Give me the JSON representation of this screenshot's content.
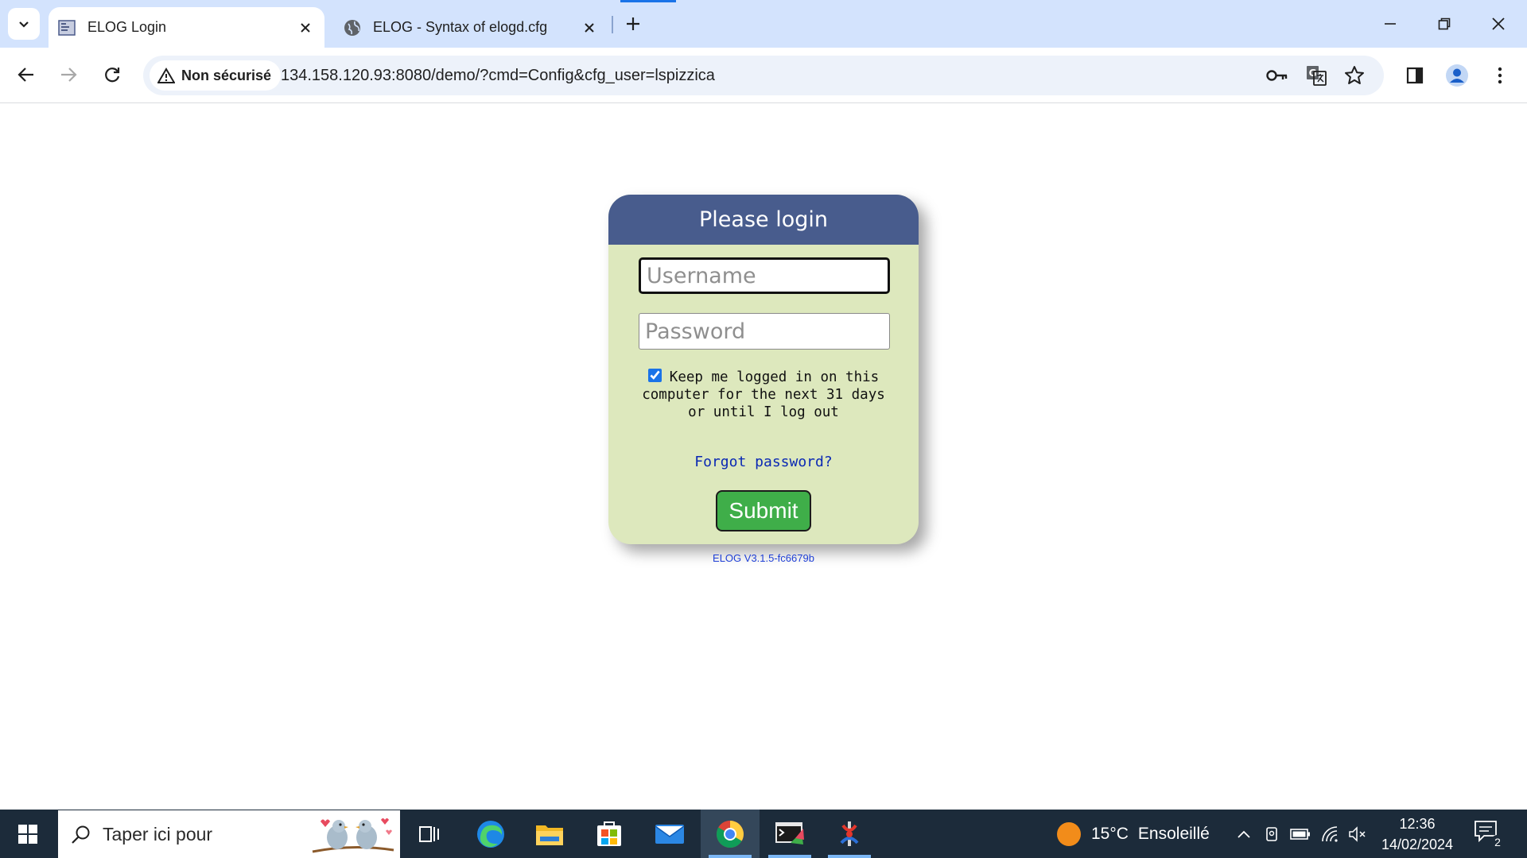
{
  "browser": {
    "tabs": [
      {
        "title": "ELOG Login",
        "active": true
      },
      {
        "title": "ELOG - Syntax of elogd.cfg",
        "active": false
      }
    ],
    "security_label": "Non sécurisé",
    "url": "134.158.120.93:8080/demo/?cmd=Config&cfg_user=lspizzica",
    "icons": {
      "tab_search": "chevron-down-icon",
      "back": "arrow-left-icon",
      "forward": "arrow-right-icon",
      "reload": "reload-icon",
      "password": "key-icon",
      "translate": "translate-icon",
      "bookmark": "star-icon",
      "side_panel": "side-panel-icon",
      "profile": "profile-icon",
      "menu": "kebab-menu-icon"
    }
  },
  "login": {
    "title": "Please login",
    "username_placeholder": "Username",
    "password_placeholder": "Password",
    "keep_logged_in_checked": true,
    "keep_logged_in_label": "Keep me logged in on this computer for the next 31 days or until I log out",
    "forgot_password": "Forgot password?",
    "submit_label": "Submit",
    "version": "ELOG V3.1.5-fc6679b"
  },
  "taskbar": {
    "search_placeholder": "Taper ici pour",
    "weather_temp": "15°C",
    "weather_text": "Ensoleillé",
    "time": "12:36",
    "date": "14/02/2024",
    "notification_count": "2",
    "apps": [
      "task-view-icon",
      "edge-icon",
      "file-explorer-icon",
      "store-icon",
      "mail-icon",
      "chrome-icon",
      "terminal-icon",
      "app-icon"
    ]
  },
  "colors": {
    "card_background": "#dde8bd",
    "card_header": "#485c8d",
    "submit_button": "#3fae49",
    "link": "#0a28b4",
    "tabstrip": "#d3e3fd",
    "taskbar": "#1c2b3a"
  }
}
